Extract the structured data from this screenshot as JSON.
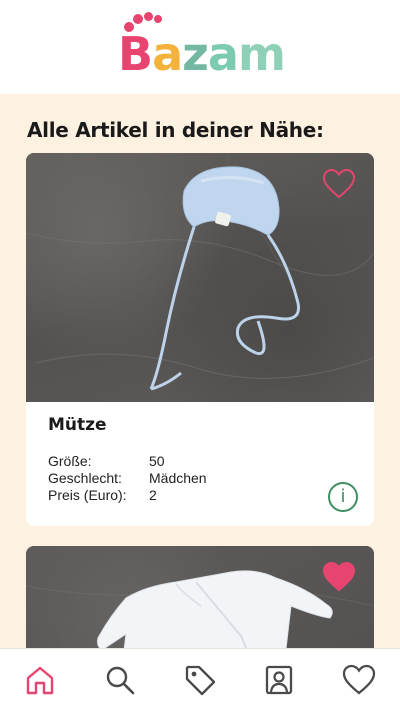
{
  "app": {
    "logo_text": "Bazam"
  },
  "page": {
    "heading": "Alle Artikel in deiner Nähe:"
  },
  "items": [
    {
      "title": "Mütze",
      "favorited": false,
      "attributes": [
        {
          "label": "Größe:",
          "value": "50"
        },
        {
          "label": "Geschlecht:",
          "value": "Mädchen"
        },
        {
          "label": "Preis (Euro):",
          "value": "2"
        }
      ],
      "info_label": "i"
    },
    {
      "favorited": true
    }
  ],
  "nav": {
    "items": [
      {
        "icon": "home-icon",
        "active": true
      },
      {
        "icon": "search-icon",
        "active": false
      },
      {
        "icon": "tag-icon",
        "active": false
      },
      {
        "icon": "profile-icon",
        "active": false
      },
      {
        "icon": "heart-icon",
        "active": false
      }
    ]
  },
  "colors": {
    "brand_pink": "#e7456f",
    "accent_green": "#3f8f64",
    "background": "#fdf1e2",
    "nav_icon": "#4a4a4a"
  }
}
